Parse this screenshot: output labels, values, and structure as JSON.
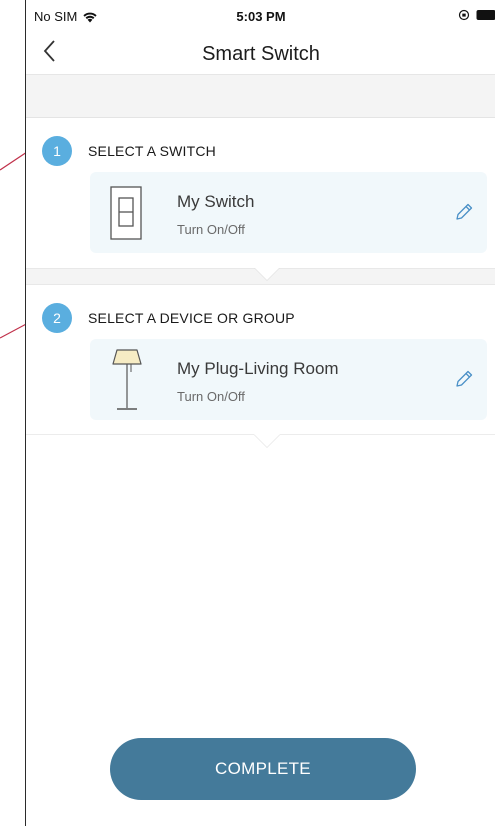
{
  "status_bar": {
    "carrier": "No SIM",
    "time": "5:03 PM",
    "icons": [
      "wifi-icon",
      "orientation-lock-icon",
      "battery-icon"
    ]
  },
  "nav": {
    "back_icon": "chevron-left-icon",
    "title": "Smart Switch"
  },
  "steps": [
    {
      "number": "1",
      "label": "SELECT A SWITCH",
      "card": {
        "icon": "wall-switch-icon",
        "name": "My Switch",
        "action": "Turn On/Off",
        "edit_icon": "pencil-icon"
      }
    },
    {
      "number": "2",
      "label": "SELECT A DEVICE OR GROUP",
      "card": {
        "icon": "floor-lamp-icon",
        "name": "My Plug-Living Room",
        "action": "Turn On/Off",
        "edit_icon": "pencil-icon"
      }
    }
  ],
  "complete_button": {
    "label": "COMPLETE"
  },
  "colors": {
    "accent": "#5aaedf",
    "button": "#447a9a",
    "card_background": "#f1f8fb",
    "callout_line": "#c0304a"
  }
}
